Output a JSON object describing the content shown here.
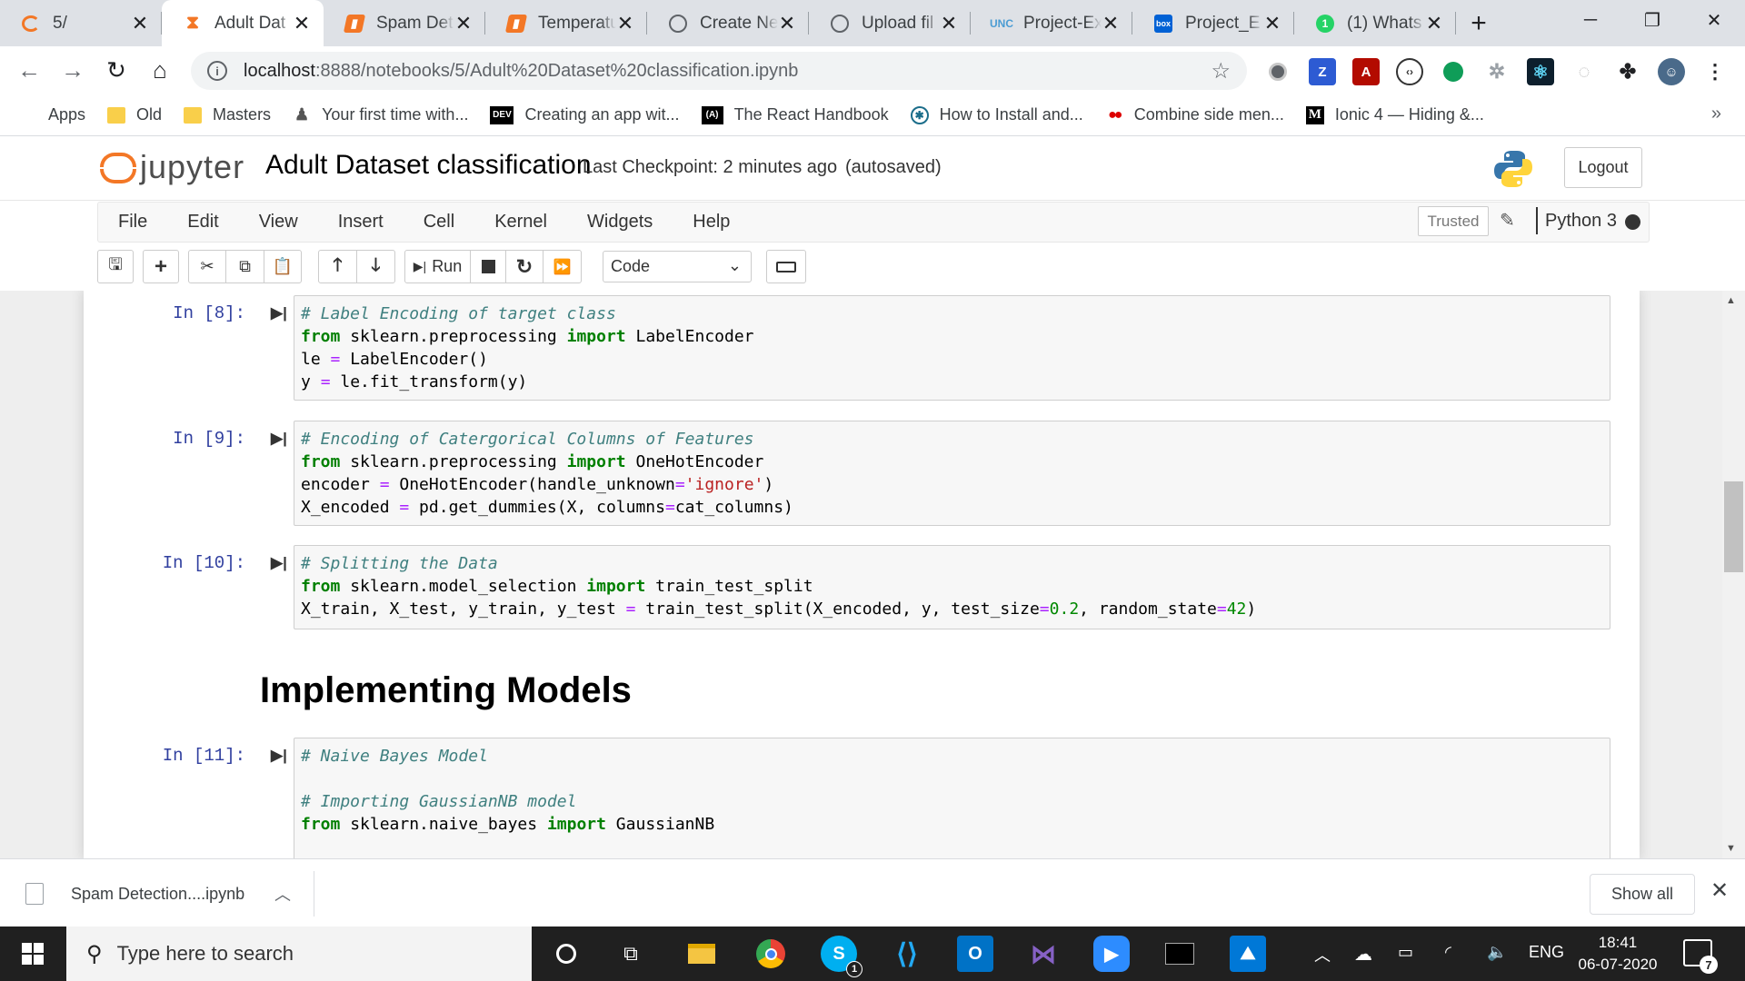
{
  "browser": {
    "tabs": [
      {
        "title": "5/",
        "icon": "loading-icon",
        "color": "#f37726"
      },
      {
        "title": "Adult Dat",
        "icon": "hourglass-icon",
        "color": "#f37726",
        "active": true
      },
      {
        "title": "Spam Det",
        "icon": "notebook-icon",
        "color": "#f37726"
      },
      {
        "title": "Temperatu",
        "icon": "notebook-icon",
        "color": "#f37726"
      },
      {
        "title": "Create Ne",
        "icon": "github-icon",
        "color": "#5f6368"
      },
      {
        "title": "Upload fil",
        "icon": "github-icon",
        "color": "#5f6368"
      },
      {
        "title": "Project-Ex",
        "icon": "unc-icon",
        "color": "#4b9cd3"
      },
      {
        "title": "Project_E",
        "icon": "box-icon",
        "color": "#0061d5"
      },
      {
        "title": "(1) Whats",
        "icon": "whatsapp-icon",
        "color": "#25d366"
      }
    ],
    "url_host": "localhost",
    "url_path": ":8888/notebooks/5/Adult%20Dataset%20classification.ipynb",
    "bookmarks": [
      {
        "label": "Apps",
        "icon": "apps-grid-icon"
      },
      {
        "label": "Old",
        "icon": "folder-icon"
      },
      {
        "label": "Masters",
        "icon": "folder-icon"
      },
      {
        "label": "Your first time with...",
        "icon": "person-icon"
      },
      {
        "label": "Creating an app wit...",
        "icon": "dev-icon"
      },
      {
        "label": "The React Handbook",
        "icon": "react-handbook-icon"
      },
      {
        "label": "How to Install and...",
        "icon": "globe-icon"
      },
      {
        "label": "Combine side men...",
        "icon": "dots-icon"
      },
      {
        "label": "Ionic 4 — Hiding &...",
        "icon": "medium-icon"
      }
    ],
    "more_label": "»"
  },
  "jupyter": {
    "logo_text": "jupyter",
    "notebook_name": "Adult Dataset classification",
    "checkpoint": "Last Checkpoint: 2 minutes ago",
    "autosave": "(autosaved)",
    "logout_label": "Logout",
    "menu": [
      "File",
      "Edit",
      "View",
      "Insert",
      "Cell",
      "Kernel",
      "Widgets",
      "Help"
    ],
    "trusted_label": "Trusted",
    "kernel_name": "Python 3",
    "run_label": "Run",
    "cell_type": "Code"
  },
  "cells": {
    "c8": {
      "prompt": "In [8]:"
    },
    "c9": {
      "prompt": "In [9]:"
    },
    "c10": {
      "prompt": "In [10]:"
    },
    "heading": "Implementing Models",
    "c11": {
      "prompt": "In [11]:"
    }
  },
  "code": {
    "c8_l1": "# Label Encoding of target class",
    "c8_l2_mod": " sklearn.preprocessing ",
    "c8_l2_cls": " LabelEncoder",
    "c8_l3": "le ",
    "c8_l3b": " LabelEncoder()",
    "c8_l4": "y ",
    "c8_l4b": " le.fit_transform(y)",
    "c9_l1": "# Encoding of Catergorical Columns of Features",
    "c9_l2_mod": " sklearn.preprocessing ",
    "c9_l2_cls": " OneHotEncoder",
    "c9_l3a": "encoder ",
    "c9_l3b": " OneHotEncoder(handle_unknown",
    "c9_l3str": "'ignore'",
    "c9_l3c": ")",
    "c9_l4a": "X_encoded ",
    "c9_l4b": " pd.get_dummies(X, columns",
    "c9_l4c": "cat_columns)",
    "c10_l1": "# Splitting the Data",
    "c10_l2_mod": " sklearn.model_selection ",
    "c10_l2_cls": " train_test_split",
    "c10_l3a": "X_train, X_test, y_train, y_test ",
    "c10_l3b": " train_test_split(X_encoded, y, test_size",
    "c10_l3num": "0.2",
    "c10_l3c": ", random_state",
    "c10_l3num2": "42",
    "c10_l3d": ")",
    "c11_l1": "# Naive Bayes Model",
    "c11_l3": "# Importing GaussianNB model",
    "c11_l4_mod": " sklearn.naive_bayes ",
    "c11_l4_cls": " GaussianNB",
    "kw_from": "from",
    "kw_import": "import",
    "op_eq": "="
  },
  "downloads": {
    "file": "Spam Detection....ipynb",
    "show_all": "Show all"
  },
  "taskbar": {
    "search_placeholder": "Type here to search",
    "lang": "ENG",
    "time": "18:41",
    "date": "06-07-2020",
    "notifications": "7",
    "skype_badge": "1"
  }
}
